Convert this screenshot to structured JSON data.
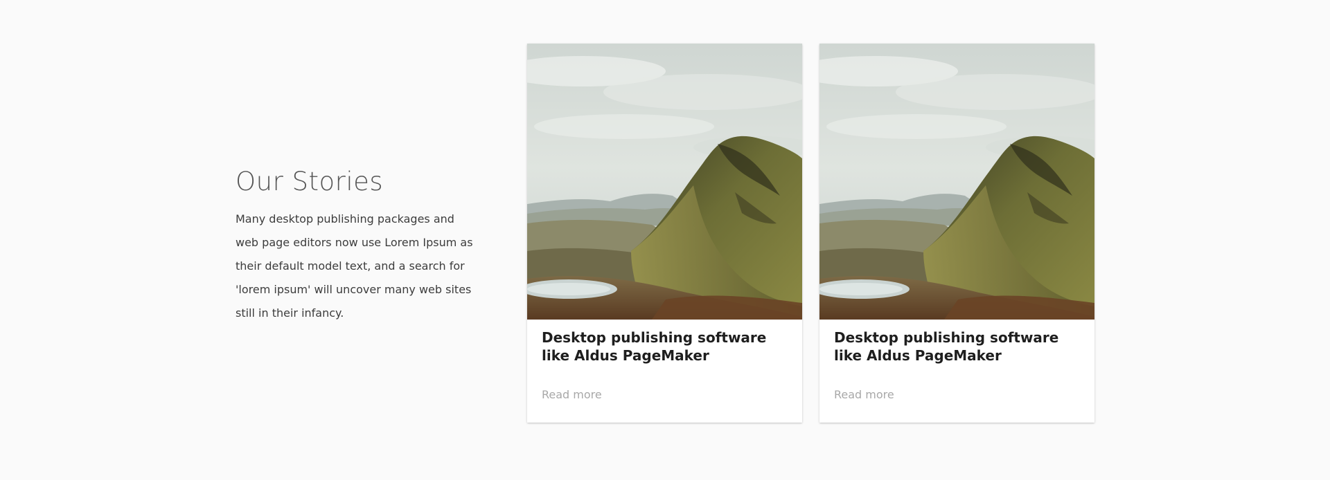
{
  "intro": {
    "title": "Our Stories",
    "text": "Many desktop publishing packages and web page editors now use Lorem Ipsum as their default model text, and a search for 'lorem ipsum' will uncover many web sites still in their infancy."
  },
  "cards": [
    {
      "image_alt": "mountain-landscape",
      "title": "Desktop publishing software like Aldus PageMaker",
      "link_label": "Read more"
    },
    {
      "image_alt": "mountain-landscape",
      "title": "Desktop publishing software like Aldus PageMaker",
      "link_label": "Read more"
    }
  ],
  "colors": {
    "background": "#fafafa",
    "card": "#ffffff",
    "title_text": "#1e1e1e",
    "muted_link": "#a8a8a8"
  }
}
